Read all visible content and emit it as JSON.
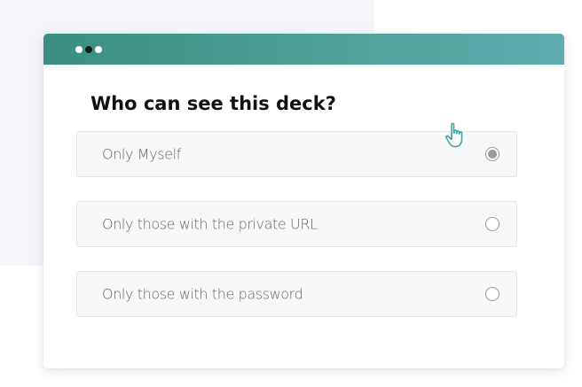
{
  "dialog": {
    "title": "Who can see this deck?"
  },
  "options": [
    {
      "label": "Only Myself",
      "selected": true
    },
    {
      "label": "Only those with the private URL",
      "selected": false
    },
    {
      "label": "Only those with the password",
      "selected": false
    }
  ],
  "colors": {
    "titlebar_start": "#3a8f80",
    "titlebar_end": "#5eaeb1",
    "cursor": "#3aa6a6"
  },
  "icons": {
    "cursor": "hand-pointer-icon"
  }
}
